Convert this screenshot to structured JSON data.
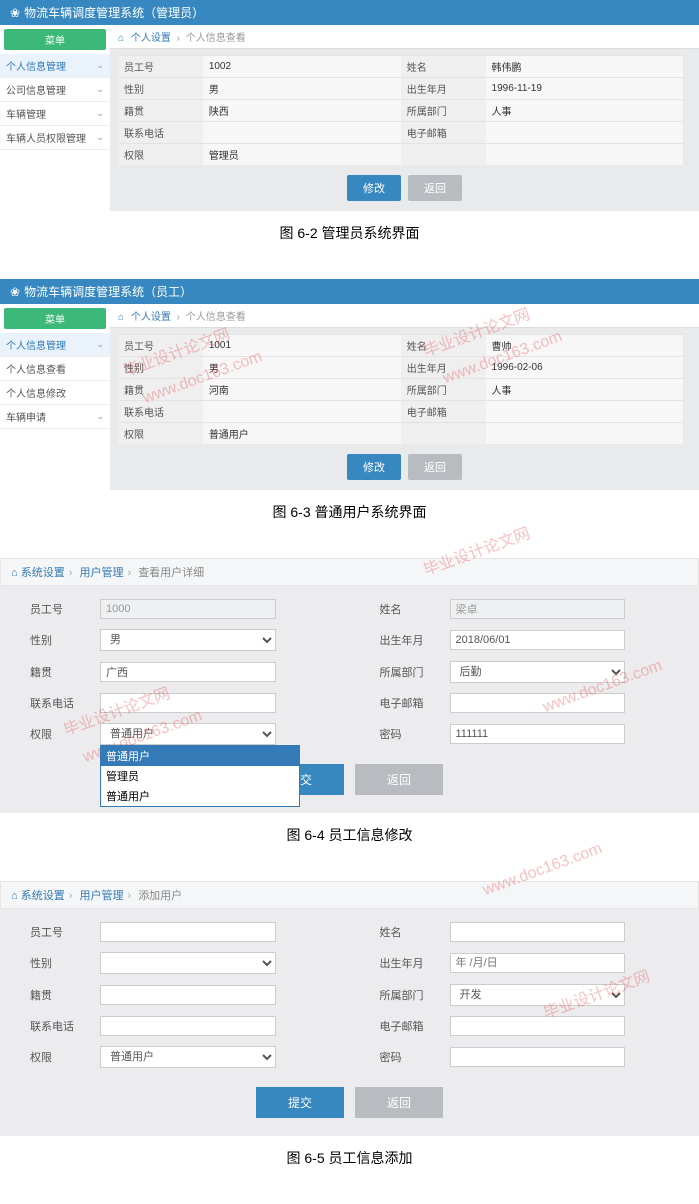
{
  "fig1": {
    "title": "物流车辆调度管理系统（管理员）",
    "sidebar": {
      "btn": "菜单",
      "items": [
        {
          "label": "个人信息管理",
          "active": true
        },
        {
          "label": "公司信息管理",
          "active": false
        },
        {
          "label": "车辆管理",
          "active": false
        },
        {
          "label": "车辆人员权限管理",
          "active": false
        }
      ]
    },
    "bc": {
      "a": "个人设置",
      "b": "个人信息查看"
    },
    "rows": [
      [
        "员工号",
        "1002",
        "姓名",
        "韩伟鹏"
      ],
      [
        "性别",
        "男",
        "出生年月",
        "1996-11-19"
      ],
      [
        "籍贯",
        "陕西",
        "所属部门",
        "人事"
      ],
      [
        "联系电话",
        "",
        "电子邮箱",
        ""
      ],
      [
        "权限",
        "管理员",
        "",
        ""
      ]
    ],
    "btns": {
      "edit": "修改",
      "back": "返回"
    },
    "caption": "图 6-2 管理员系统界面"
  },
  "fig2": {
    "title": "物流车辆调度管理系统（员工）",
    "sidebar": {
      "btn": "菜单",
      "items": [
        {
          "label": "个人信息管理",
          "active": true
        },
        {
          "label": "个人信息查看",
          "active": false
        },
        {
          "label": "个人信息修改",
          "active": false
        },
        {
          "label": "车辆申请",
          "active": false
        }
      ]
    },
    "bc": {
      "a": "个人设置",
      "b": "个人信息查看"
    },
    "rows": [
      [
        "员工号",
        "1001",
        "姓名",
        "曹帅"
      ],
      [
        "性别",
        "男",
        "出生年月",
        "1996-02-06"
      ],
      [
        "籍贯",
        "河南",
        "所属部门",
        "人事"
      ],
      [
        "联系电话",
        "",
        "电子邮箱",
        ""
      ],
      [
        "权限",
        "普通用户",
        "",
        ""
      ]
    ],
    "btns": {
      "edit": "修改",
      "back": "返回"
    },
    "caption": "图 6-3 普通用户系统界面"
  },
  "fig3": {
    "bc": {
      "a": "系统设置",
      "b": "用户管理",
      "c": "查看用户详细"
    },
    "labels": {
      "id": "员工号",
      "name": "姓名",
      "sex": "性别",
      "dob": "出生年月",
      "origin": "籍贯",
      "dept": "所属部门",
      "phone": "联系电话",
      "email": "电子邮箱",
      "role": "权限",
      "pwd": "密码"
    },
    "values": {
      "id": "1000",
      "name": "梁卓",
      "sex": "男",
      "dob": "2018/06/01",
      "origin": "广西",
      "dept": "后勤",
      "phone": "",
      "email": "",
      "role": "普通用户",
      "pwd": "111111"
    },
    "role_opts": [
      "普通用户",
      "管理员",
      "普通用户"
    ],
    "btns": {
      "submit": "提交",
      "back": "返回"
    },
    "caption": "图 6-4 员工信息修改"
  },
  "fig4": {
    "bc": {
      "a": "系统设置",
      "b": "用户管理",
      "c": "添加用户"
    },
    "labels": {
      "id": "员工号",
      "name": "姓名",
      "sex": "性别",
      "dob": "出生年月",
      "origin": "籍贯",
      "dept": "所属部门",
      "phone": "联系电话",
      "email": "电子邮箱",
      "role": "权限",
      "pwd": "密码"
    },
    "values": {
      "id": "",
      "name": "",
      "sex": "",
      "dob_ph": "年 /月/日",
      "origin": "",
      "dept": "开发",
      "phone": "",
      "email": "",
      "role": "普通用户",
      "pwd": ""
    },
    "btns": {
      "submit": "提交",
      "back": "返回"
    },
    "caption": "图 6-5 员工信息添加"
  },
  "wm": {
    "t1": "毕业设计论文网",
    "t2": "www.doc163.com"
  }
}
